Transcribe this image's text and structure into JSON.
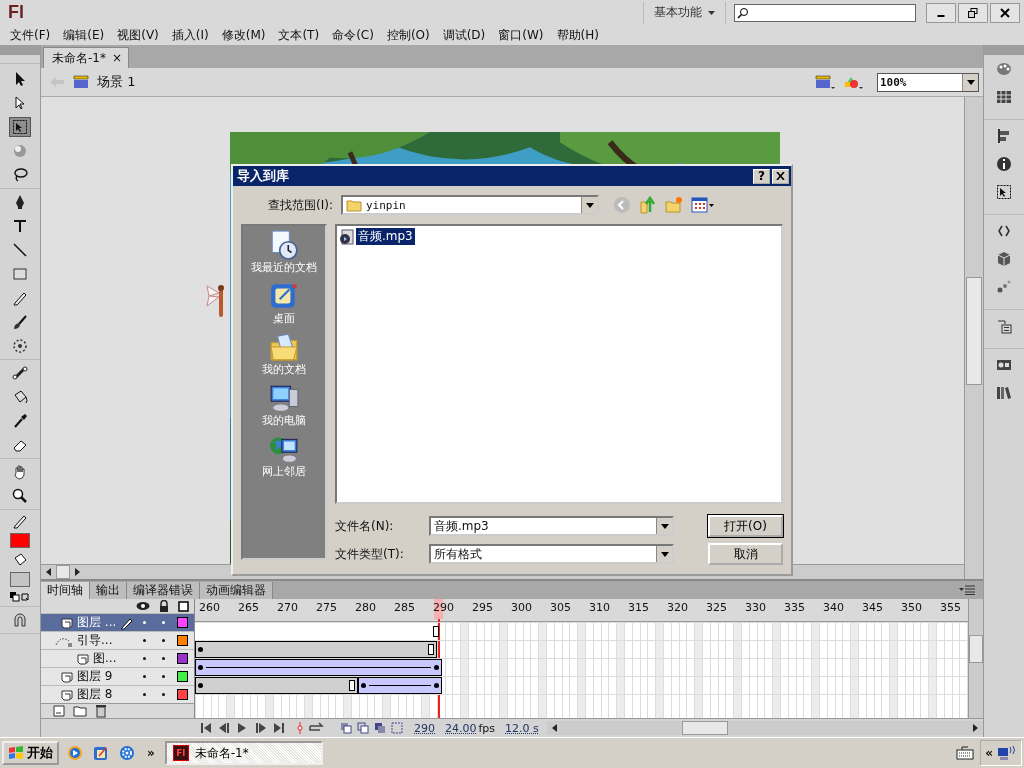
{
  "app": {
    "logo": "Fl",
    "workspace": "基本功能"
  },
  "menu": [
    "文件(F)",
    "编辑(E)",
    "视图(V)",
    "插入(I)",
    "修改(M)",
    "文本(T)",
    "命令(C)",
    "控制(O)",
    "调试(D)",
    "窗口(W)",
    "帮助(H)"
  ],
  "document_tabs": [
    {
      "label": "未命名-1*",
      "selected": true,
      "close": "×"
    }
  ],
  "scene": {
    "label": "场景 1"
  },
  "zoom": {
    "value": "100%"
  },
  "tools": [
    {
      "kind": "arrow",
      "selected": false
    },
    {
      "kind": "subselect",
      "selected": false
    },
    {
      "kind": "transform",
      "selected": true
    },
    {
      "kind": "rotate3d",
      "selected": false
    },
    {
      "kind": "lasso",
      "selected": false
    },
    {
      "kind": "pen",
      "selected": false
    },
    {
      "kind": "text",
      "selected": false
    },
    {
      "kind": "line",
      "selected": false
    },
    {
      "kind": "rect",
      "selected": false
    },
    {
      "kind": "pencil",
      "selected": false
    },
    {
      "kind": "brush",
      "selected": false
    },
    {
      "kind": "deco",
      "selected": false
    },
    {
      "kind": "bone",
      "selected": false
    },
    {
      "kind": "bucket",
      "selected": false
    },
    {
      "kind": "eyedropper",
      "selected": false
    },
    {
      "kind": "eraser",
      "selected": false
    },
    {
      "kind": "hand",
      "selected": false
    },
    {
      "kind": "zoom",
      "selected": false
    }
  ],
  "colors": {
    "stroke": {
      "color": "#ff0000"
    },
    "fill": {
      "color": "#c4c4c4"
    }
  },
  "dock": [
    {
      "kind": "palette"
    },
    {
      "kind": "grid"
    },
    {
      "kind": "align"
    },
    {
      "kind": "info"
    },
    {
      "kind": "transform"
    },
    {
      "kind": "code"
    },
    {
      "kind": "cube"
    },
    {
      "kind": "dots"
    },
    {
      "kind": "library"
    },
    {
      "kind": "movie"
    },
    {
      "kind": "books"
    }
  ],
  "dialog": {
    "title": "导入到库",
    "help": "?",
    "look_in": {
      "label": "查找范围(I):",
      "value": "yinpin"
    },
    "places": [
      {
        "label": "我最近的文档",
        "kind": "recent"
      },
      {
        "label": "桌面",
        "kind": "desktop"
      },
      {
        "label": "我的文档",
        "kind": "documents"
      },
      {
        "label": "我的电脑",
        "kind": "computer"
      },
      {
        "label": "网上邻居",
        "kind": "network"
      }
    ],
    "files": [
      {
        "name": "音频.mp3",
        "selected": true
      }
    ],
    "file_name": {
      "label": "文件名(N):",
      "value": "音频.mp3"
    },
    "file_type": {
      "label": "文件类型(T):",
      "value": "所有格式"
    },
    "buttons": [
      {
        "label": "打开(O)",
        "default": true
      },
      {
        "label": "取消",
        "default": false
      }
    ]
  },
  "timeline": {
    "tabs": [
      {
        "label": "时间轴",
        "selected": true
      },
      {
        "label": "输出",
        "selected": false
      },
      {
        "label": "编译器错误",
        "selected": false
      },
      {
        "label": "动画编辑器",
        "selected": false
      }
    ],
    "ruler": [
      "260",
      "265",
      "270",
      "275",
      "280",
      "285",
      "290",
      "295",
      "300",
      "305",
      "310",
      "315",
      "320",
      "325",
      "330",
      "335",
      "340",
      "345",
      "350",
      "355"
    ],
    "playhead": {
      "level": 0.315
    },
    "layers": [
      {
        "name": "图层 ...",
        "kind": "layer",
        "selected": true,
        "editing": true,
        "color": "#ff44ff",
        "frames": {
          "kind": "empty-end"
        }
      },
      {
        "name": "引导...",
        "kind": "guide",
        "selected": false,
        "editing": false,
        "color": "#ff8000",
        "frames": {
          "kind": "hold"
        },
        "children": [
          {
            "name": "图...",
            "kind": "layer",
            "selected": false,
            "editing": false,
            "color": "#9933cc",
            "frames": {
              "kind": "tween"
            }
          }
        ]
      },
      {
        "name": "图层 9",
        "kind": "layer",
        "selected": false,
        "editing": false,
        "color": "#44ee44",
        "frames": {
          "kind": "hold-tween"
        }
      },
      {
        "name": "图层 8",
        "kind": "layer",
        "selected": false,
        "editing": false,
        "color": "#ff4444",
        "frames": {
          "kind": "none"
        }
      }
    ],
    "current_frame": "290",
    "fps": "24.00",
    "fps_unit": "fps",
    "elapsed": "12.0 s"
  },
  "taskbar": {
    "start": "开始",
    "quick_launch": [
      {
        "kind": "media"
      },
      {
        "kind": "edit"
      },
      {
        "kind": "gear"
      }
    ],
    "more": "»",
    "tasks": [
      {
        "label": "未命名-1*",
        "icon_text": "Fl",
        "selected": true
      }
    ],
    "tray_expand": "«"
  }
}
